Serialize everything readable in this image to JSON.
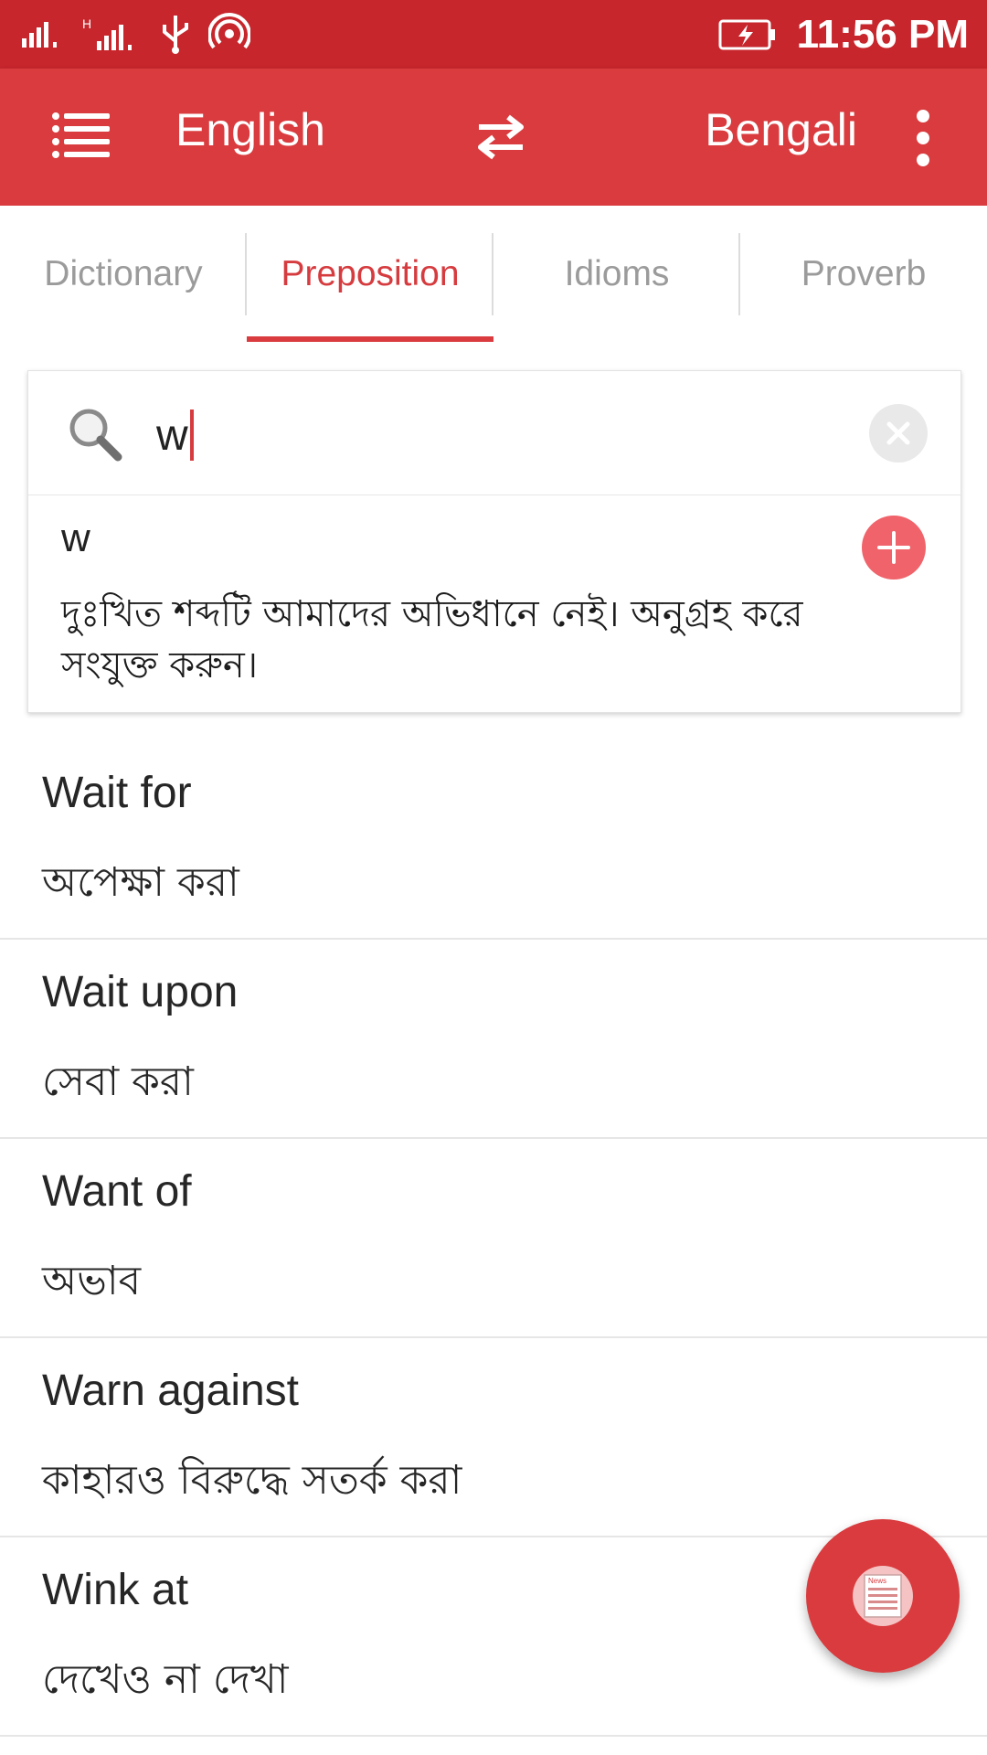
{
  "status_bar": {
    "time": "11:56 PM",
    "icons": [
      "signal-1-icon",
      "signal-2-icon",
      "usb-icon",
      "hotspot-icon",
      "battery-charging-icon"
    ]
  },
  "app_bar": {
    "source_language": "English",
    "target_language": "Bengali",
    "icons": [
      "menu-icon",
      "swap-icon",
      "more-vert-icon"
    ],
    "accent_color": "#d93b3e"
  },
  "tabs": [
    {
      "label": "Dictionary",
      "active": false
    },
    {
      "label": "Preposition",
      "active": true
    },
    {
      "label": "Idioms",
      "active": false
    },
    {
      "label": "Proverb",
      "active": false
    }
  ],
  "search": {
    "value": "w",
    "result_word": "w",
    "result_message": "দুঃখিত শব্দটি আমাদের অভিধানে নেই। অনুগ্রহ করে সংযুক্ত করুন।"
  },
  "list": [
    {
      "title": "Wait for",
      "meaning": "অপেক্ষা করা"
    },
    {
      "title": "Wait upon",
      "meaning": "সেবা করা"
    },
    {
      "title": "Want of",
      "meaning": "অভাব"
    },
    {
      "title": "Warn against",
      "meaning": "কাহারও বিরুদ্ধে সতর্ক করা"
    },
    {
      "title": "Wink at",
      "meaning": "দেখেও না দেখা"
    }
  ],
  "fab": {
    "icon": "news-icon",
    "icon_text": "News"
  }
}
